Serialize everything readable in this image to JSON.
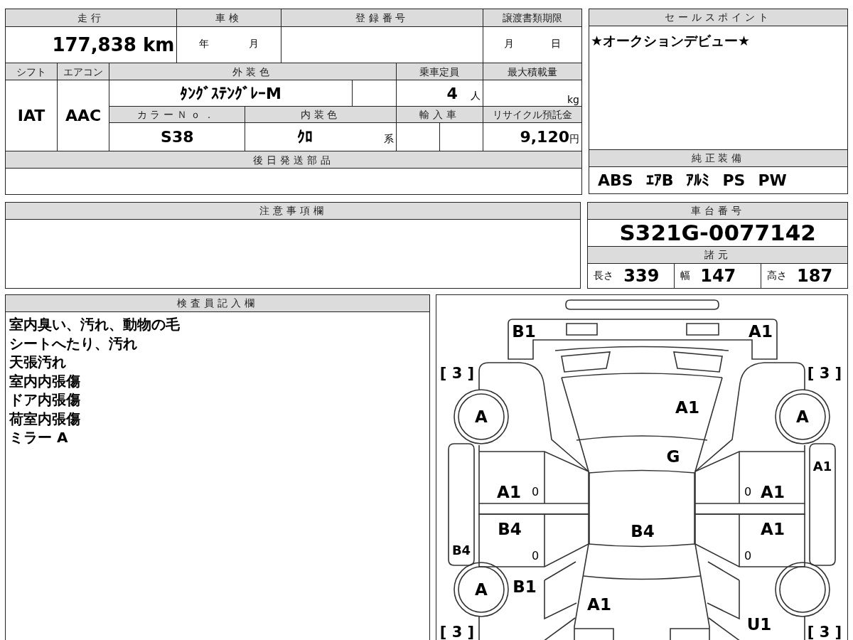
{
  "mileage": {
    "label": "走行",
    "value": "177,838 km"
  },
  "inspection": {
    "label": "車検",
    "year_unit": "年",
    "month_unit": "月"
  },
  "registration_number": {
    "label": "登録番号"
  },
  "transfer_deadline": {
    "label": "譲渡書類期限",
    "month_unit": "月",
    "day_unit": "日"
  },
  "shift": {
    "label": "シフト",
    "value": "IAT"
  },
  "air_conditioner": {
    "label": "エアコン",
    "value": "AAC"
  },
  "exterior_color": {
    "label": "外装色",
    "value": "ﾀﾝｸﾞｽﾃﾝｸﾞﾚｰM"
  },
  "seating_capacity": {
    "label": "乗車定員",
    "value": "4",
    "unit": "人"
  },
  "max_load": {
    "label": "最大積載量",
    "unit": "kg"
  },
  "color_number": {
    "label": "カラーＮｏ．",
    "value": "S38"
  },
  "interior_color": {
    "label": "内装色",
    "value": "ｸﾛ",
    "suffix": "系"
  },
  "imported_car": {
    "label": "輸入車"
  },
  "recycle_fee": {
    "label": "リサイクル預託金",
    "value": "9,120",
    "unit": "円"
  },
  "parts_shipped_later": {
    "label": "後日発送部品"
  },
  "remarks": {
    "label": "注意事項欄"
  },
  "inspector_notes": {
    "label": "検査員記入欄",
    "lines": [
      "室内臭い、汚れ、動物の毛",
      "シートへたり、汚れ",
      "天張汚れ",
      "室内内張傷",
      "ドア内張傷",
      "荷室内張傷",
      "ミラー A"
    ]
  },
  "sales_points": {
    "label": "セールスポイント",
    "text": "★オークションデビュー★"
  },
  "standard_equipment": {
    "label": "純正装備",
    "items": [
      "ABS",
      "ｴｱB",
      "ｱﾙﾐ",
      "PS",
      "PW"
    ]
  },
  "chassis_number": {
    "label": "車台番号",
    "value": "S321G-0077142"
  },
  "specifications": {
    "label": "諸元",
    "items": [
      {
        "label": "長さ",
        "value": "339"
      },
      {
        "label": "幅",
        "value": "147"
      },
      {
        "label": "高さ",
        "value": "187"
      }
    ]
  },
  "damage_diagram": {
    "tread": {
      "front_left": {
        "text": "[ 3 ]"
      },
      "front_right": {
        "text": "[ 3 ]"
      },
      "rear_left": {
        "text": "[ 3 ]"
      },
      "rear_right": {
        "text": "[ 3 ]"
      }
    },
    "tires": {
      "front_left": {
        "code": "A"
      },
      "front_right": {
        "code": "A"
      },
      "rear_left": {
        "code": "A"
      }
    },
    "marks": {
      "front_bumper_left": {
        "kind": "damage",
        "code": "B1"
      },
      "front_bumper_right": {
        "kind": "damage",
        "code": "A1"
      },
      "hood": {
        "kind": "damage",
        "code": "A1"
      },
      "windshield": {
        "kind": "damage",
        "code": "G"
      },
      "right_sill": {
        "kind": "sill",
        "code": "A1"
      },
      "front_left_door": {
        "kind": "damage",
        "code": "A1"
      },
      "front_left_window": {
        "kind": "window",
        "code": "0"
      },
      "front_right_window": {
        "kind": "window",
        "code": "0"
      },
      "front_right_door": {
        "kind": "damage",
        "code": "A1"
      },
      "rear_left_door": {
        "kind": "damage",
        "code": "B4"
      },
      "roof": {
        "kind": "damage",
        "code": "B4"
      },
      "rear_right_door": {
        "kind": "damage",
        "code": "A1"
      },
      "left_sill": {
        "kind": "sill",
        "code": "B4"
      },
      "rear_left_window": {
        "kind": "window",
        "code": "0"
      },
      "rear_right_window": {
        "kind": "window",
        "code": "0"
      },
      "rear_left_quarter": {
        "kind": "damage",
        "code": "B1"
      },
      "trunk": {
        "kind": "damage",
        "code": "A1"
      },
      "rear_right_quarter": {
        "kind": "damage",
        "code": "U1"
      }
    }
  }
}
